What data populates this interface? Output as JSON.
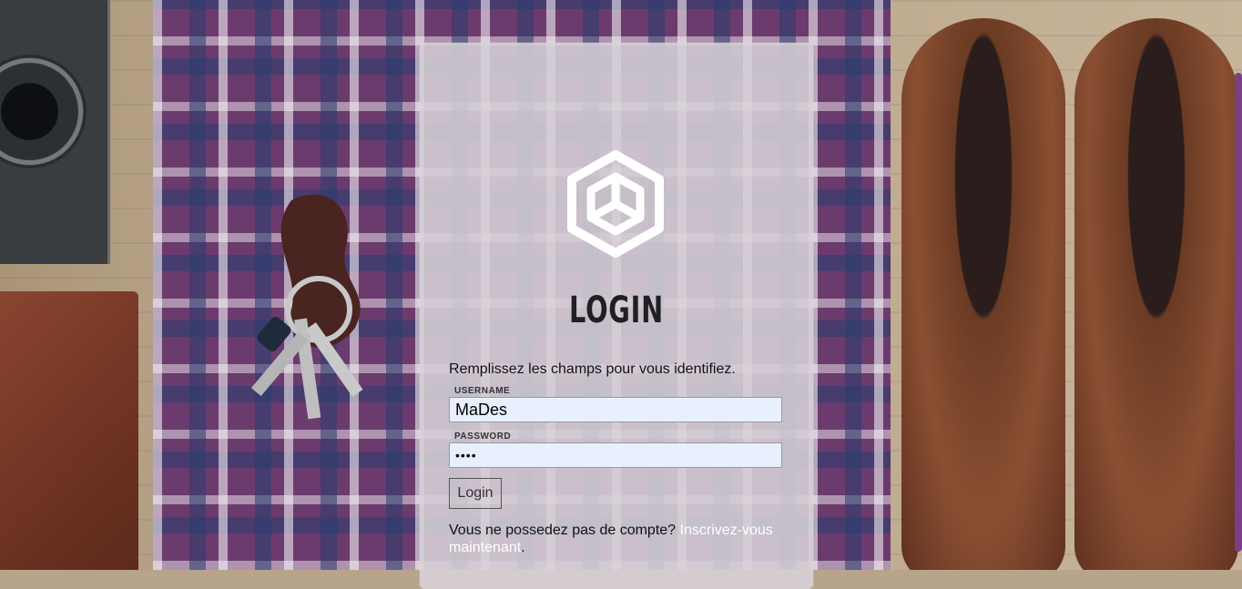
{
  "login": {
    "title": "LOGIN",
    "intro": "Remplissez les champs pour vous identifiez.",
    "username_label": "USERNAME",
    "username_value": "MaDes",
    "password_label": "PASSWORD",
    "password_value": "••••",
    "button_label": "Login",
    "signup_prefix": "Vous ne possedez pas de compte?",
    "signup_link": "Inscrivez-vous maintenant",
    "signup_suffix": "."
  },
  "colors": {
    "panel": "#d7d2d7",
    "link": "#ffffff",
    "scrollbar": "#7b3f86",
    "field_bg": "#e8f0fe"
  },
  "icons": [
    "cube-logo-icon"
  ]
}
